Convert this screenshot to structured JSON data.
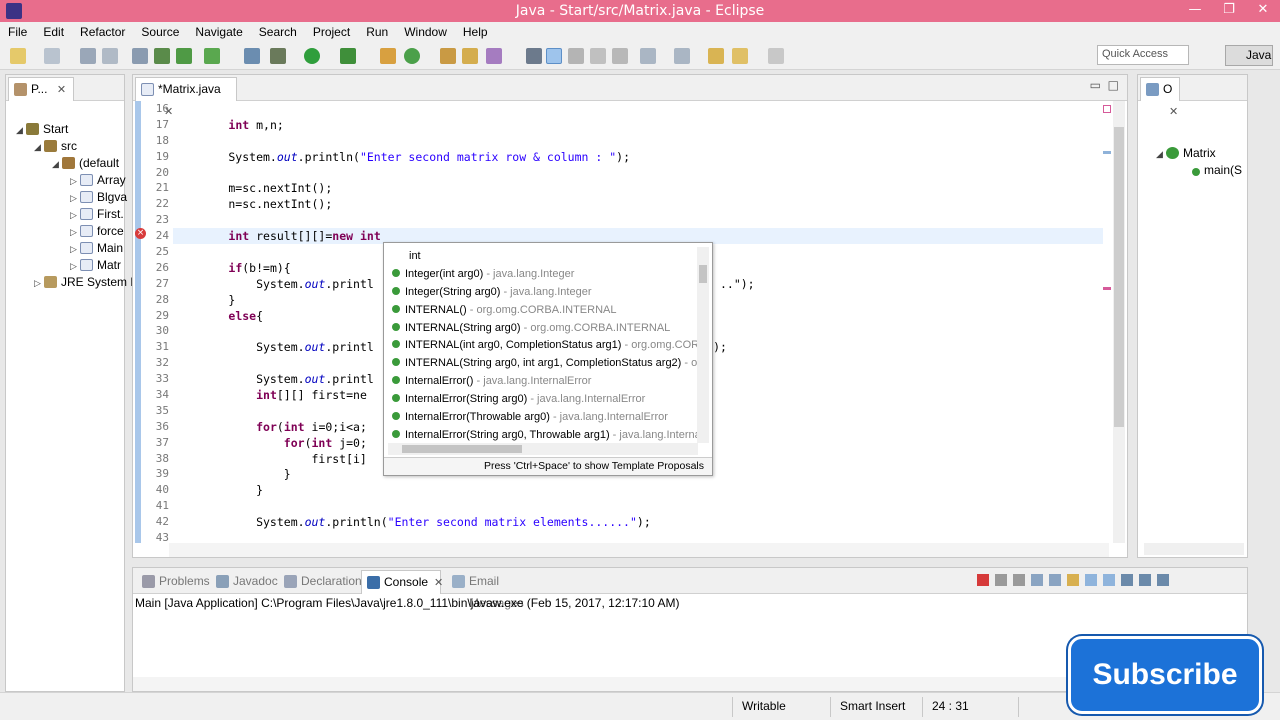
{
  "window": {
    "title": "Java - Start/src/Matrix.java - Eclipse",
    "controls": [
      "—",
      "❐",
      "✕"
    ]
  },
  "menu": [
    "File",
    "Edit",
    "Refactor",
    "Source",
    "Navigate",
    "Search",
    "Project",
    "Run",
    "Window",
    "Help"
  ],
  "toolbar": {
    "quick_access_placeholder": "Quick Access",
    "perspective": "Java"
  },
  "package_explorer": {
    "tab_label": "P...",
    "tree": [
      {
        "label": "Start",
        "depth": 0,
        "arrow": "◢",
        "icon": "project-icon"
      },
      {
        "label": "src",
        "depth": 1,
        "arrow": "◢",
        "icon": "source-folder-icon"
      },
      {
        "label": "(default",
        "depth": 2,
        "arrow": "◢",
        "icon": "package-icon"
      },
      {
        "label": "Array",
        "depth": 3,
        "arrow": "▷",
        "icon": "java-file-icon"
      },
      {
        "label": "Blgva",
        "depth": 3,
        "arrow": "▷",
        "icon": "java-file-icon"
      },
      {
        "label": "First.",
        "depth": 3,
        "arrow": "▷",
        "icon": "java-file-icon"
      },
      {
        "label": "force",
        "depth": 3,
        "arrow": "▷",
        "icon": "java-file-icon"
      },
      {
        "label": "Main",
        "depth": 3,
        "arrow": "▷",
        "icon": "java-file-icon"
      },
      {
        "label": "Matr",
        "depth": 3,
        "arrow": "▷",
        "icon": "java-file-icon"
      },
      {
        "label": "JRE System L",
        "depth": 1,
        "arrow": "▷",
        "icon": "library-icon"
      }
    ]
  },
  "editor": {
    "tab_label": "*Matrix.java",
    "line_numbers": [
      "16",
      "17",
      "18",
      "19",
      "20",
      "21",
      "22",
      "23",
      "24",
      "25",
      "26",
      "27",
      "28",
      "29",
      "30",
      "31",
      "32",
      "33",
      "34",
      "35",
      "36",
      "37",
      "38",
      "39",
      "40",
      "41",
      "42",
      "43"
    ],
    "lines": [
      "",
      "        int m,n;",
      "",
      "        System.out.println(\"Enter second matrix row & column : \");",
      "",
      "        m=sc.nextInt();",
      "        n=sc.nextInt();",
      "",
      "        int result[][]=new int",
      "",
      "        if(b!=m){",
      "            System.out.printl                                                  ..\");",
      "        }",
      "        else{",
      "",
      "            System.out.printl                                                 );",
      "",
      "            System.out.printl",
      "            int[][] first=ne",
      "",
      "            for(int i=0;i<a;",
      "                for(int j=0;",
      "                    first[i]",
      "                }",
      "            }",
      "",
      "            System.out.println(\"Enter second matrix elements......\");",
      ""
    ]
  },
  "content_assist": {
    "header": "int",
    "items": [
      {
        "name": "Integer(int arg0)",
        "pkg": " - java.lang.Integer"
      },
      {
        "name": "Integer(String arg0)",
        "pkg": " - java.lang.Integer"
      },
      {
        "name": "INTERNAL()",
        "pkg": " - org.omg.CORBA.INTERNAL"
      },
      {
        "name": "INTERNAL(String arg0)",
        "pkg": " - org.omg.CORBA.INTERNAL"
      },
      {
        "name": "INTERNAL(int arg0, CompletionStatus arg1)",
        "pkg": " - org.omg.CORBA.INTERNAL"
      },
      {
        "name": "INTERNAL(String arg0, int arg1, CompletionStatus arg2)",
        "pkg": " - org.omg.CORBA.INTERNAL"
      },
      {
        "name": "InternalError()",
        "pkg": " - java.lang.InternalError"
      },
      {
        "name": "InternalError(String arg0)",
        "pkg": " - java.lang.InternalError"
      },
      {
        "name": "InternalError(Throwable arg0)",
        "pkg": " - java.lang.InternalError"
      },
      {
        "name": "InternalError(String arg0, Throwable arg1)",
        "pkg": " - java.lang.InternalError"
      }
    ],
    "footer": "Press 'Ctrl+Space' to show Template Proposals"
  },
  "outline": {
    "tab_label": "O",
    "items": [
      {
        "label": "Matrix"
      },
      {
        "label": "main(S"
      }
    ]
  },
  "bottom_panel": {
    "tabs": [
      {
        "label": "Problems",
        "icon": "problems-icon"
      },
      {
        "label": "Javadoc",
        "icon": "javadoc-icon"
      },
      {
        "label": "Declaration",
        "icon": "declaration-icon"
      },
      {
        "label": "Console",
        "icon": "console-icon"
      },
      {
        "label": "Email Messages",
        "icon": "email-icon"
      }
    ],
    "console_header": "Main [Java Application] C:\\Program Files\\Java\\jre1.8.0_111\\bin\\javaw.exe (Feb 15, 2017, 12:17:10 AM)"
  },
  "status": {
    "writable": "Writable",
    "insert_mode": "Smart Insert",
    "position": "24 : 31"
  },
  "overlay": {
    "subscribe": "Subscribe"
  },
  "colors": {
    "titlebar": "#e86d8c",
    "keyword": "#7f0055",
    "string": "#2a00ff",
    "field": "#0000c0",
    "subscribe": "#1c72d8"
  }
}
